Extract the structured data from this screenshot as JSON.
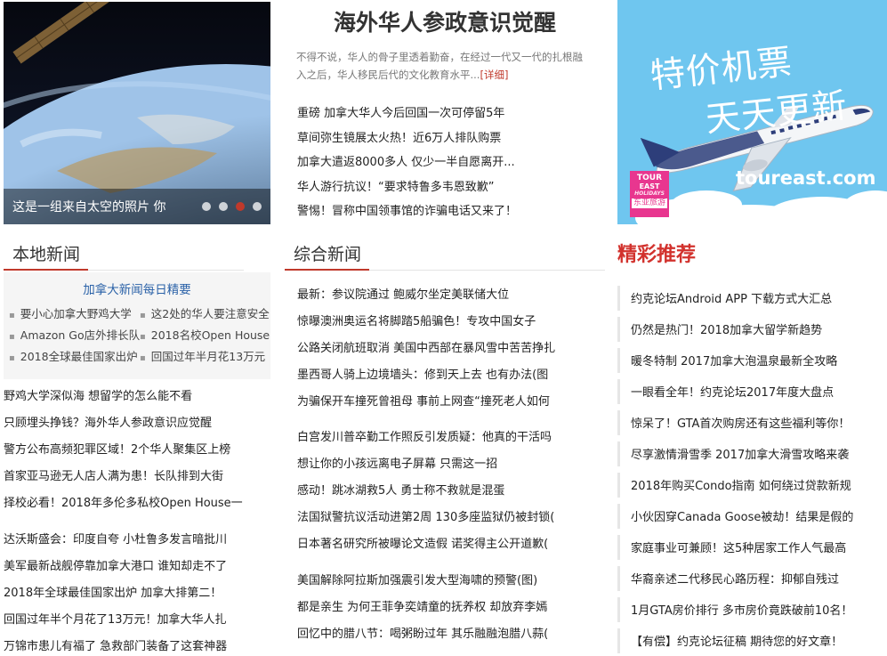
{
  "slideshow": {
    "caption": "这是一组来自太空的照片 你",
    "dots": [
      "1",
      "2",
      "3",
      "4"
    ],
    "active_dot": 2
  },
  "headline": {
    "title": "海外华人参政意识觉醒",
    "description": "不得不说，华人的骨子里透着勤奋，在经过一代又一代的扎根融入之后，华人移民后代的文化教育水平...",
    "more_label": "[详细]",
    "items": [
      "重磅 加拿大华人今后回国一次可停留5年",
      "草间弥生镜展太火热！近6万人排队购票",
      "加拿大遣返8000多人 仅少一半自愿离开...",
      "华人游行抗议！“要求特鲁多韦恩致歉”",
      "警惕！冒称中国领事馆的诈骗电话又来了！"
    ]
  },
  "ad": {
    "line1": "特价机票",
    "line2": "天天更新",
    "domain": "toureast.com",
    "logo_line1": "TOUR",
    "logo_line2": "EAST",
    "logo_line3": "HOLIDAYS",
    "logo_line4": "东亚旅游"
  },
  "local_news": {
    "section_title": "本地新闻",
    "digest_title": "加拿大新闻每日精要",
    "digest_rows": [
      [
        "要小心加拿大野鸡大学",
        "这2处的华人要注意安全"
      ],
      [
        "Amazon Go店外排长队",
        "2018名校Open House"
      ],
      [
        "2018全球最佳国家出炉",
        "回国过年半月花13万元"
      ]
    ],
    "list_a": [
      "野鸡大学深似海 想留学的怎么能不看",
      "只顾埋头挣钱？海外华人参政意识应觉醒",
      "警方公布高频犯罪区域！2个华人聚集区上榜",
      "首家亚马逊无人店人满为患！长队排到大街",
      "择校必看！2018年多伦多私校Open House一"
    ],
    "list_b": [
      "达沃斯盛会：印度自夸 小杜鲁多发言暗批川",
      "美军最新战舰停靠加拿大港口 谁知却走不了",
      "2018年全球最佳国家出炉 加拿大排第二！",
      "回国过年半个月花了13万元！加拿大华人扎",
      "万锦市患儿有福了 急救部门装备了这套神器"
    ]
  },
  "general_news": {
    "section_title": "综合新闻",
    "list_a": [
      "最新：参议院通过 鲍威尔坐定美联储大位",
      "惊曝澳洲奥运名将脚踏5船骗色！专攻中国女子",
      "公路关闭航班取消 美国中西部在暴风雪中苦苦挣扎",
      "墨西哥人骑上边境墙头：修到天上去 也有办法(图",
      "为骗保开车撞死曾祖母 事前上网查“撞死老人如何"
    ],
    "list_b": [
      "白宫发川普卒勤工作照反引发质疑：他真的干活吗",
      "想让你的小孩远离电子屏幕 只需这一招",
      "感动！跳冰湖救5人 勇士称不救就是混蛋",
      "法国狱警抗议活动进第2周 130多座监狱仍被封锁(",
      "日本著名研究所被曝论文造假 诺奖得主公开道歉("
    ],
    "list_c": [
      "美国解除阿拉斯加强震引发大型海啸的预警(图)",
      "都是亲生 为何王菲争奕靖童的抚养权 却放弃李嫣",
      "回忆中的腊八节：喝粥盼过年 其乐融融泡腊八蒜("
    ]
  },
  "picks": {
    "section_title": "精彩推荐",
    "items": [
      "约克论坛Android APP 下载方式大汇总",
      "仍然是热门！2018加拿大留学新趋势",
      "暖冬特制 2017加拿大泡温泉最新全攻略",
      "一眼看全年！约克论坛2017年度大盘点",
      "惊呆了！GTA首次购房还有这些福利等你！",
      "尽享激情滑雪季 2017加拿大滑雪攻略来袭",
      "2018年购买Condo指南 如何绕过贷款新规",
      "小伙因穿Canada Goose被劫！结果是假的",
      "家庭事业可兼顾！这5种居家工作人气最高",
      "华裔亲述二代移民心路历程：抑郁自残过",
      "1月GTA房价排行 多市房价竟跌破前10名！",
      "【有偿】约克论坛征稿 期待您的好文章！"
    ]
  },
  "colors": {
    "accent_red": "#c0392b",
    "picks_title": "#d2322d",
    "digest_link": "#2b62a8",
    "ad_sky": "#6fc6ef",
    "ad_logo": "#e8368f"
  },
  "icons": {
    "airplane": "airplane-illustration",
    "slide_dot": "slide-dot-icon"
  }
}
